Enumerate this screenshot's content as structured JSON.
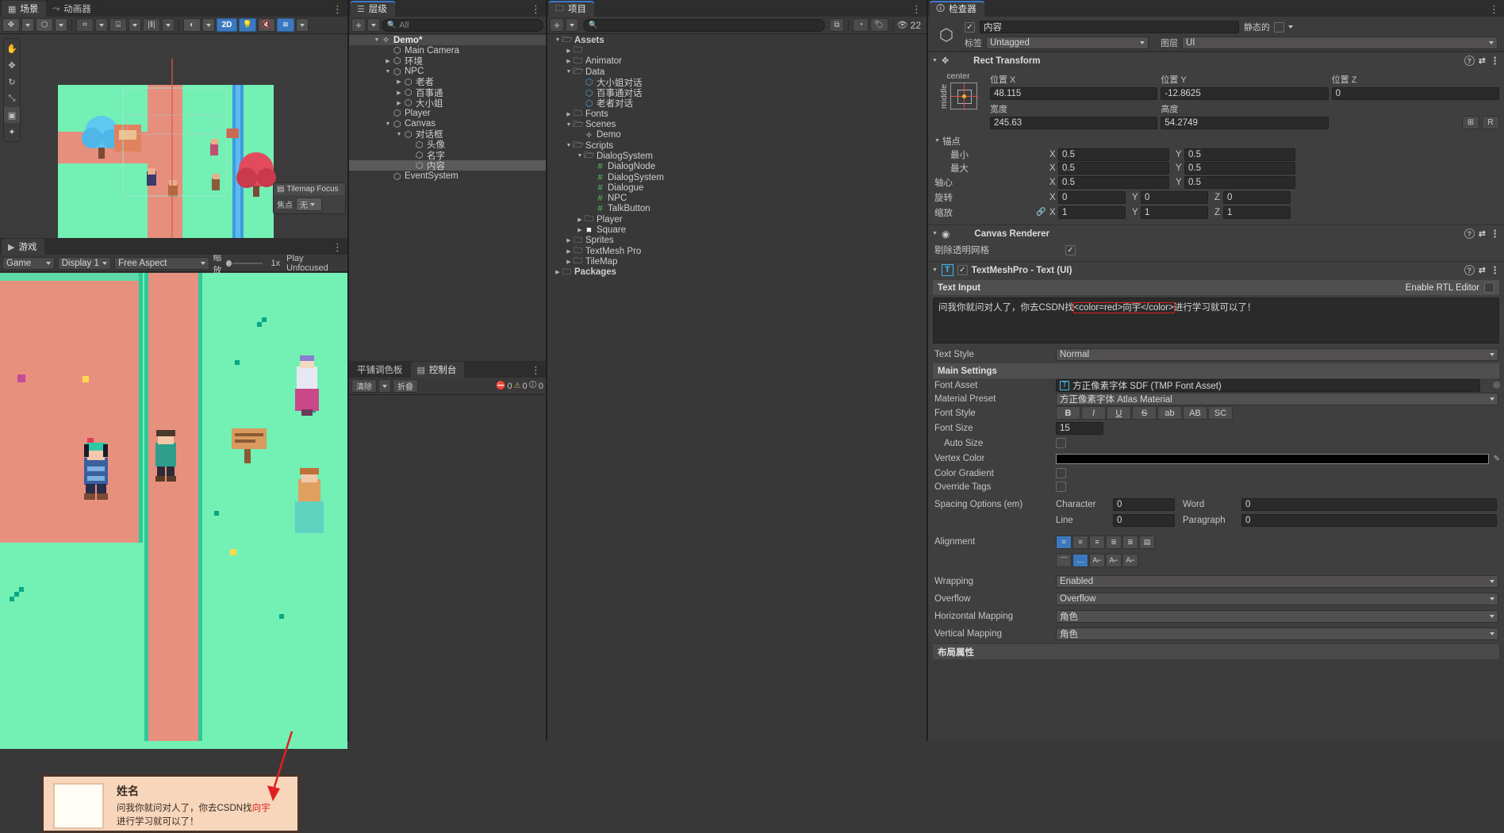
{
  "scene_panel": {
    "tabs": [
      {
        "label": "场景",
        "icon": "grid-icon",
        "active": true
      },
      {
        "label": "动画器",
        "icon": "animator-icon",
        "active": false
      }
    ],
    "toolbar": {
      "pivot": "Center",
      "rotation": "Global",
      "mode_2d": "2D",
      "lighting": "light-icon",
      "audio": "audio-mute-icon",
      "fx": "fx-icon",
      "shading": "shading-icon",
      "gizmos": "gizmos-icon",
      "camera": "camera-icon"
    },
    "tilemap_focus": {
      "title": "Tilemap Focus",
      "label": "焦点",
      "value": "无"
    },
    "left_tools": [
      "hand-icon",
      "move-icon",
      "rotate-icon",
      "scale-icon",
      "rect-icon",
      "transform-icon"
    ]
  },
  "game_panel": {
    "tabs": [
      {
        "label": "游戏",
        "icon": "game-icon",
        "active": true
      }
    ],
    "toolbar": {
      "target": "Game",
      "display": "Display 1",
      "aspect": "Free Aspect",
      "scale_label": "缩放",
      "scale_value": "1x",
      "play_focused": "Play Unfocused"
    },
    "dialog": {
      "name": "姓名",
      "text_before": "问我你就问对人了，你去CSDN找",
      "text_highlight": "向宇",
      "text_after": "进行学习就可以了！"
    }
  },
  "hierarchy_panel": {
    "tabs": [
      {
        "label": "层级",
        "icon": "hierarchy-icon",
        "active": true
      }
    ],
    "toolbar": {
      "add": "+",
      "search_placeholder": "All"
    },
    "items": [
      {
        "label": "Demo*",
        "depth": 0,
        "arrow": "down",
        "icon": "unity-scene-icon",
        "type": "scene"
      },
      {
        "label": "Main Camera",
        "depth": 1,
        "arrow": "none",
        "icon": "gameobject-icon"
      },
      {
        "label": "环境",
        "depth": 1,
        "arrow": "right",
        "icon": "gameobject-icon"
      },
      {
        "label": "NPC",
        "depth": 1,
        "arrow": "down",
        "icon": "gameobject-icon"
      },
      {
        "label": "老者",
        "depth": 2,
        "arrow": "right",
        "icon": "gameobject-icon"
      },
      {
        "label": "百事通",
        "depth": 2,
        "arrow": "right",
        "icon": "gameobject-icon"
      },
      {
        "label": "大小姐",
        "depth": 2,
        "arrow": "right",
        "icon": "gameobject-icon"
      },
      {
        "label": "Player",
        "depth": 1,
        "arrow": "none",
        "icon": "gameobject-icon"
      },
      {
        "label": "Canvas",
        "depth": 1,
        "arrow": "down",
        "icon": "gameobject-icon"
      },
      {
        "label": "对话框",
        "depth": 2,
        "arrow": "down",
        "icon": "gameobject-icon"
      },
      {
        "label": "头像",
        "depth": 3,
        "arrow": "none",
        "icon": "gameobject-icon"
      },
      {
        "label": "名字",
        "depth": 3,
        "arrow": "none",
        "icon": "gameobject-icon"
      },
      {
        "label": "内容",
        "depth": 3,
        "arrow": "none",
        "icon": "gameobject-icon",
        "selected": true
      },
      {
        "label": "EventSystem",
        "depth": 1,
        "arrow": "none",
        "icon": "gameobject-icon"
      }
    ]
  },
  "console_panel": {
    "tabs": [
      {
        "label": "平铺调色板",
        "active": false
      },
      {
        "label": "控制台",
        "icon": "console-icon",
        "active": true
      }
    ],
    "toolbar": {
      "clear": "清除",
      "collapse": "折叠",
      "error_count": "0",
      "warning_count": "0",
      "info_count": "0"
    }
  },
  "project_panel": {
    "tabs": [
      {
        "label": "项目",
        "icon": "folder-icon",
        "active": true
      }
    ],
    "toolbar": {
      "add": "+",
      "search_placeholder": "",
      "layer_count": "22"
    },
    "items": [
      {
        "label": "Assets",
        "depth": 0,
        "arrow": "down",
        "icon": "folder-open-icon",
        "bold": true
      },
      {
        "label": "",
        "depth": 1,
        "arrow": "right",
        "icon": "folder-icon"
      },
      {
        "label": "Animator",
        "depth": 1,
        "arrow": "right",
        "icon": "folder-icon"
      },
      {
        "label": "Data",
        "depth": 1,
        "arrow": "down",
        "icon": "folder-open-icon"
      },
      {
        "label": "大小姐对话",
        "depth": 2,
        "arrow": "none",
        "icon": "scriptable-object-icon"
      },
      {
        "label": "百事通对话",
        "depth": 2,
        "arrow": "none",
        "icon": "scriptable-object-icon"
      },
      {
        "label": "老者对话",
        "depth": 2,
        "arrow": "none",
        "icon": "scriptable-object-icon"
      },
      {
        "label": "Fonts",
        "depth": 1,
        "arrow": "right",
        "icon": "folder-icon"
      },
      {
        "label": "Scenes",
        "depth": 1,
        "arrow": "down",
        "icon": "folder-open-icon"
      },
      {
        "label": "Demo",
        "depth": 2,
        "arrow": "none",
        "icon": "unity-scene-icon"
      },
      {
        "label": "Scripts",
        "depth": 1,
        "arrow": "down",
        "icon": "folder-open-icon"
      },
      {
        "label": "DialogSystem",
        "depth": 2,
        "arrow": "down",
        "icon": "folder-open-icon"
      },
      {
        "label": "DialogNode",
        "depth": 3,
        "arrow": "none",
        "icon": "cs-script-icon"
      },
      {
        "label": "DialogSystem",
        "depth": 3,
        "arrow": "none",
        "icon": "cs-script-icon"
      },
      {
        "label": "Dialogue",
        "depth": 3,
        "arrow": "none",
        "icon": "cs-script-icon"
      },
      {
        "label": "NPC",
        "depth": 3,
        "arrow": "none",
        "icon": "cs-script-icon"
      },
      {
        "label": "TalkButton",
        "depth": 3,
        "arrow": "none",
        "icon": "cs-script-icon"
      },
      {
        "label": "Player",
        "depth": 2,
        "arrow": "right",
        "icon": "folder-icon"
      },
      {
        "label": "Square",
        "depth": 2,
        "arrow": "right",
        "icon": "white-square-icon"
      },
      {
        "label": "Sprites",
        "depth": 1,
        "arrow": "right",
        "icon": "folder-icon"
      },
      {
        "label": "TextMesh Pro",
        "depth": 1,
        "arrow": "right",
        "icon": "folder-icon"
      },
      {
        "label": "TileMap",
        "depth": 1,
        "arrow": "right",
        "icon": "folder-icon"
      },
      {
        "label": "Packages",
        "depth": 0,
        "arrow": "right",
        "icon": "folder-icon",
        "bold": true
      }
    ]
  },
  "inspector": {
    "tabs": [
      {
        "label": "检查器",
        "icon": "info-icon",
        "active": true
      }
    ],
    "object": {
      "name": "内容",
      "enabled": true,
      "static_label": "静态的",
      "tag_label": "标签",
      "tag_value": "Untagged",
      "layer_label": "图层",
      "layer_value": "UI"
    },
    "rect_transform": {
      "title": "Rect Transform",
      "anchor_preset_h": "center",
      "anchor_preset_v": "middle",
      "pos_x_label": "位置 X",
      "pos_x": "48.115",
      "pos_y_label": "位置 Y",
      "pos_y": "-12.8625",
      "pos_z_label": "位置 Z",
      "pos_z": "0",
      "width_label": "宽度",
      "width": "245.63",
      "height_label": "高度",
      "height": "54.2749",
      "blueprint": "R",
      "anchors_label": "锚点",
      "min_label": "最小",
      "min_x": "0.5",
      "min_y": "0.5",
      "max_label": "最大",
      "max_x": "0.5",
      "max_y": "0.5",
      "pivot_label": "轴心",
      "pivot_x": "0.5",
      "pivot_y": "0.5",
      "rotation_label": "旋转",
      "rot_x": "0",
      "rot_y": "0",
      "rot_z": "0",
      "scale_label": "缩放",
      "scale_x": "1",
      "scale_y": "1",
      "scale_z": "1"
    },
    "canvas_renderer": {
      "title": "Canvas Renderer",
      "cull_label": "剔除透明网格",
      "cull_checked": true
    },
    "tmp": {
      "title": "TextMeshPro - Text (UI)",
      "enabled": true,
      "text_input_label": "Text Input",
      "rtl_label": "Enable RTL Editor",
      "rtl_checked": false,
      "text_plain": "问我你就问对人了，你去CSDN找",
      "text_tag": "<color=red>向宇</color>",
      "text_suffix": "进行学习就可以了！",
      "text_style_label": "Text Style",
      "text_style_value": "Normal",
      "main_settings_label": "Main Settings",
      "font_asset_label": "Font Asset",
      "font_asset_value": "方正像素字体 SDF (TMP Font Asset)",
      "material_preset_label": "Material Preset",
      "material_preset_value": "方正像素字体 Atlas Material",
      "font_style_label": "Font Style",
      "font_style_buttons": [
        "B",
        "I",
        "U",
        "S",
        "ab",
        "AB",
        "SC"
      ],
      "font_size_label": "Font Size",
      "font_size_value": "15",
      "auto_size_label": "Auto Size",
      "auto_size_checked": false,
      "vertex_color_label": "Vertex Color",
      "vertex_color_value": "#000000",
      "color_gradient_label": "Color Gradient",
      "color_gradient_checked": false,
      "override_tags_label": "Override Tags",
      "override_tags_checked": false,
      "spacing_label": "Spacing Options (em)",
      "spacing_character_label": "Character",
      "spacing_character": "0",
      "spacing_word_label": "Word",
      "spacing_word": "0",
      "spacing_line_label": "Line",
      "spacing_line": "0",
      "spacing_paragraph_label": "Paragraph",
      "spacing_paragraph": "0",
      "alignment_label": "Alignment",
      "wrapping_label": "Wrapping",
      "wrapping_value": "Enabled",
      "overflow_label": "Overflow",
      "overflow_value": "Overflow",
      "horizontal_mapping_label": "Horizontal Mapping",
      "horizontal_mapping_value": "角色",
      "vertical_mapping_label": "Vertical Mapping",
      "vertical_mapping_value": "角色"
    },
    "layout_props_label": "布局属性"
  },
  "colors": {
    "accent_blue": "#3b79bf",
    "panel_bg": "#383838",
    "dark_bg": "#1e1e1e",
    "red_highlight": "#e03030",
    "game_green": "#73f0b4",
    "dialog_bg": "#f7d6bc"
  }
}
